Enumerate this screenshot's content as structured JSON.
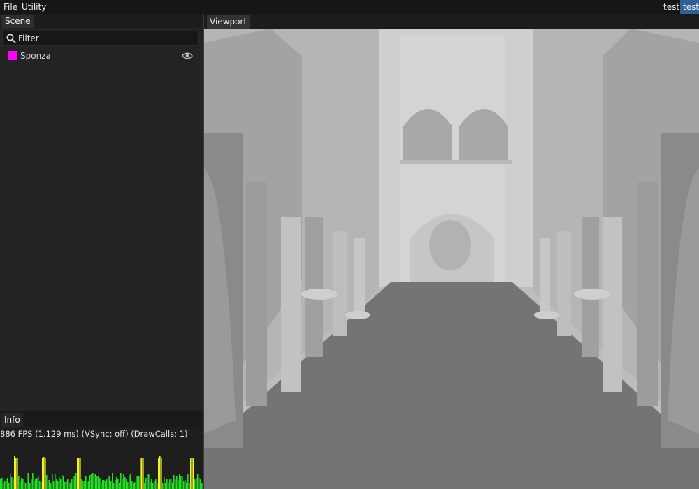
{
  "menubar": {
    "items": [
      "File",
      "Utility"
    ],
    "mode_tabs": [
      "test",
      "test"
    ]
  },
  "scene_panel": {
    "tab": "Scene",
    "filter": {
      "placeholder": "Filter",
      "value": ""
    },
    "items": [
      {
        "label": "Sponza",
        "color": "#ff00ff",
        "visible": true
      }
    ]
  },
  "info_panel": {
    "tab": "Info",
    "stats": "886 FPS (1.129 ms) (VSync: off) (DrawCalls: 1)"
  },
  "viewport": {
    "tab": "Viewport",
    "scene": "Sponza atrium grayscale render"
  },
  "colors": {
    "accent": "#2f5f93",
    "graph_green": "#22dd22",
    "graph_yellow": "#f2f224"
  },
  "icons": [
    "search-icon",
    "eye-icon"
  ]
}
